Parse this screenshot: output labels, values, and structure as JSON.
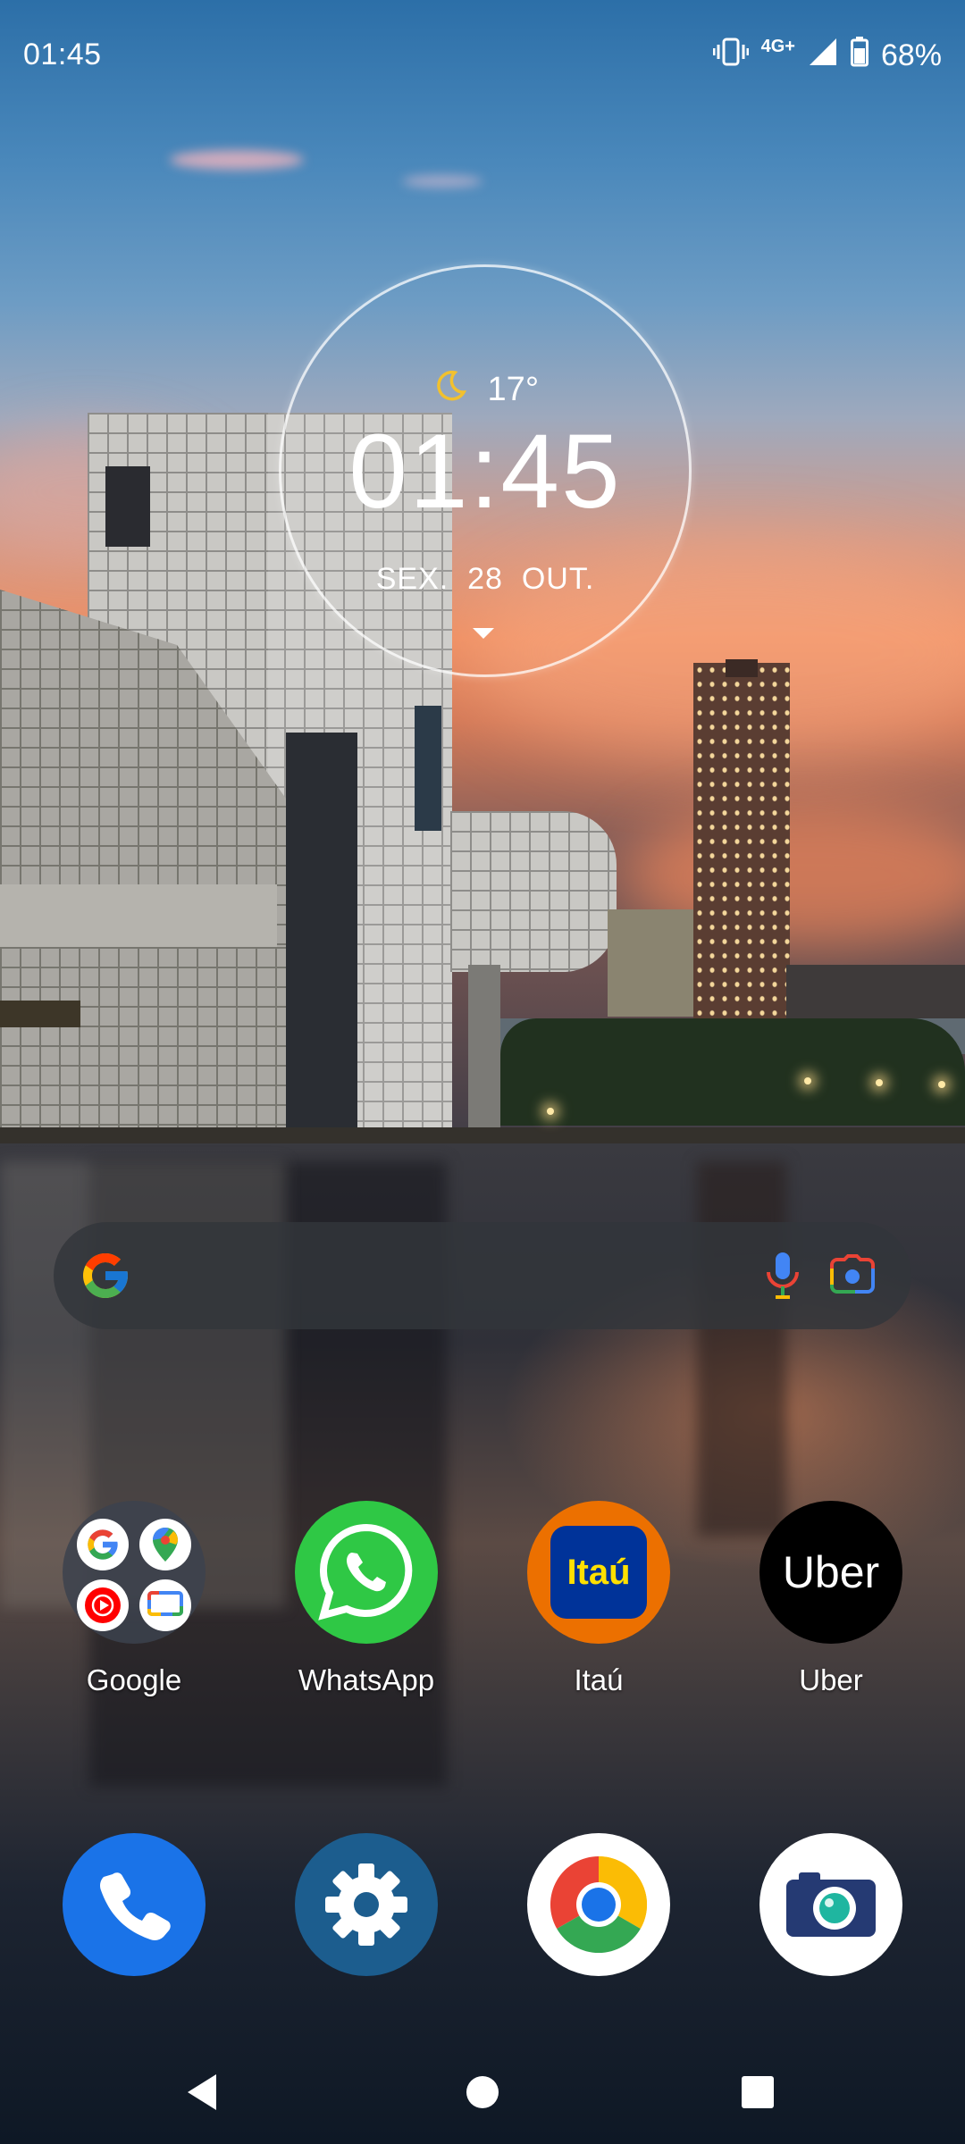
{
  "status_bar": {
    "time": "01:45",
    "network": "4G+",
    "battery": "68%",
    "icons": [
      "vibrate-icon",
      "signal-icon",
      "battery-icon"
    ]
  },
  "clock_widget": {
    "temperature": "17°",
    "weather_icon": "moon-icon",
    "time": "01:45",
    "date": "SEX.  28  OUT."
  },
  "search": {
    "placeholder": "",
    "icons": [
      "google-g-icon",
      "microphone-icon",
      "lens-camera-icon"
    ]
  },
  "apps": [
    {
      "label": "Google",
      "icon": "google-folder-icon"
    },
    {
      "label": "WhatsApp",
      "icon": "whatsapp-icon"
    },
    {
      "label": "Itaú",
      "icon": "itau-icon",
      "icon_text": "Itaú"
    },
    {
      "label": "Uber",
      "icon": "uber-icon",
      "icon_text": "Uber"
    }
  ],
  "dock": [
    {
      "icon": "phone-icon"
    },
    {
      "icon": "settings-icon"
    },
    {
      "icon": "chrome-icon"
    },
    {
      "icon": "camera-icon"
    }
  ],
  "nav": {
    "icons": [
      "back-icon",
      "home-icon",
      "recents-icon"
    ]
  },
  "colors": {
    "whatsapp": "#2fc845",
    "itau_orange": "#ec7000",
    "itau_blue": "#003399",
    "uber": "#000000",
    "phone": "#1a73e8",
    "settings": "#1c5d8e"
  }
}
